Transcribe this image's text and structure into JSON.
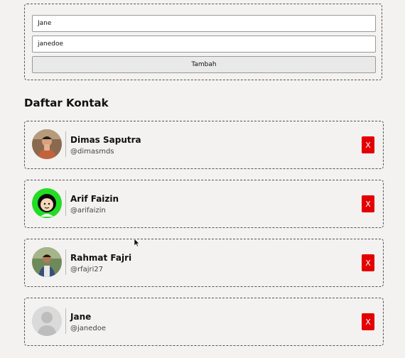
{
  "form": {
    "name_value": "Jane",
    "username_value": "janedoe",
    "submit_label": "Tambah"
  },
  "list_title": "Daftar Kontak",
  "contacts": [
    {
      "name": "Dimas Saputra",
      "handle": "@dimasmds",
      "avatar": "photo-avatar",
      "delete_label": "X"
    },
    {
      "name": "Arif Faizin",
      "handle": "@arifaizin",
      "avatar": "cartoon-avatar",
      "delete_label": "X"
    },
    {
      "name": "Rahmat Fajri",
      "handle": "@rfajri27",
      "avatar": "photo-avatar",
      "delete_label": "X"
    },
    {
      "name": "Jane",
      "handle": "@janedoe",
      "avatar": "default-user-avatar",
      "delete_label": "X"
    }
  ],
  "colors": {
    "background": "#f3f2f1",
    "delete_button": "#e40000",
    "cartoon_avatar_bg": "#22dd22"
  }
}
